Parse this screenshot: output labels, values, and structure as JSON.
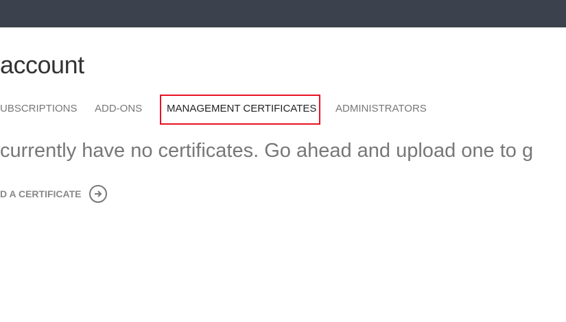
{
  "header": {
    "title": "account"
  },
  "tabs": [
    {
      "label": "UBSCRIPTIONS",
      "active": false
    },
    {
      "label": "ADD-ONS",
      "active": false
    },
    {
      "label": "MANAGEMENT CERTIFICATES",
      "active": true
    },
    {
      "label": "ADMINISTRATORS",
      "active": false
    }
  ],
  "main": {
    "message": "currently have no certificates. Go ahead and upload one to g",
    "upload_label": "D A CERTIFICATE",
    "upload_icon": "arrow-right-circle-icon"
  },
  "colors": {
    "topbar": "#3c424d",
    "highlight": "#e81123"
  }
}
